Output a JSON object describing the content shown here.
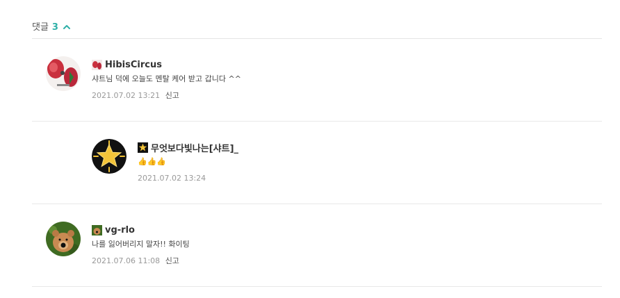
{
  "header": {
    "label": "댓글",
    "count": "3"
  },
  "comments": [
    {
      "author": "HibisCircus",
      "text": "샤트님 덕에 오늘도 멘탈 케어 받고 갑니다 ^^",
      "date": "2021.07.02 13:21",
      "report": "신고"
    },
    {
      "author": "무엇보다빛나는[샤트]_",
      "text": "👍👍👍",
      "date": "2021.07.02 13:24"
    },
    {
      "author": "vg-rlo",
      "text": "나를 잃어버리지 말자!! 화이팅",
      "date": "2021.07.06 11:08",
      "report": "신고"
    }
  ],
  "colors": {
    "accent": "#2fb0a8",
    "date": "#999999",
    "divider": "#e5e5e5"
  }
}
